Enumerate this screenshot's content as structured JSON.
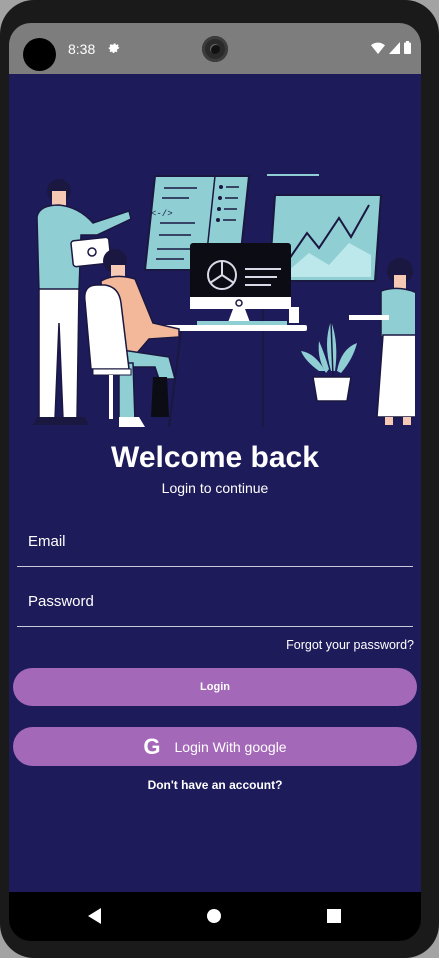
{
  "status_bar": {
    "time": "8:38",
    "icons": [
      "settings-icon",
      "wifi-icon",
      "signal-icon",
      "battery-icon"
    ]
  },
  "illustration": {
    "icons": [
      "code-snippet-icon",
      "pie-chart-icon",
      "line-chart-icon",
      "plant-icon"
    ],
    "code_text": "<-/>"
  },
  "login": {
    "title": "Welcome back",
    "subtitle": "Login to continue",
    "email_label": "Email",
    "password_label": "Password",
    "forgot_password": "Forgot your password?",
    "login_button": "Login",
    "google_button": "Login With google",
    "google_icon": "G",
    "signup_link": "Don't have an account?"
  },
  "colors": {
    "background": "#1e1b5b",
    "button": "#a468b9",
    "accent_teal": "#8fcfd4"
  },
  "nav_bar": [
    "back-icon",
    "home-icon",
    "recents-icon"
  ]
}
